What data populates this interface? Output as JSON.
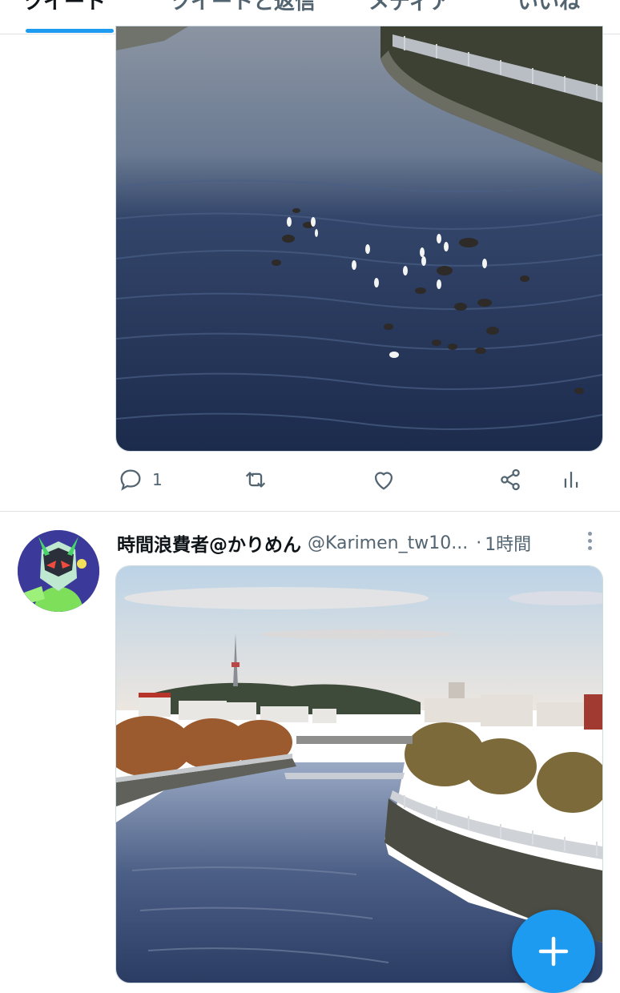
{
  "tabs": [
    {
      "label": "ツイート",
      "active": true
    },
    {
      "label": "ツイートと返信",
      "active": false
    },
    {
      "label": "メディア",
      "active": false
    },
    {
      "label": "いいね",
      "active": false
    }
  ],
  "tweet1": {
    "media_alt": "",
    "actions": {
      "reply_count": "1",
      "retweet_count": "",
      "like_count": ""
    }
  },
  "tweet2": {
    "display_name": "時間浪費者@かりめん",
    "handle": "@Karimen_tw10...",
    "separator": "·",
    "time": "1時間"
  },
  "colors": {
    "accent": "#1d9bf0",
    "secondary_text": "#536471",
    "divider": "#dfe3e6"
  },
  "icons": [
    "reply-icon",
    "retweet-icon",
    "like-icon",
    "share-icon",
    "analytics-icon",
    "more-icon",
    "compose-plus-icon"
  ]
}
